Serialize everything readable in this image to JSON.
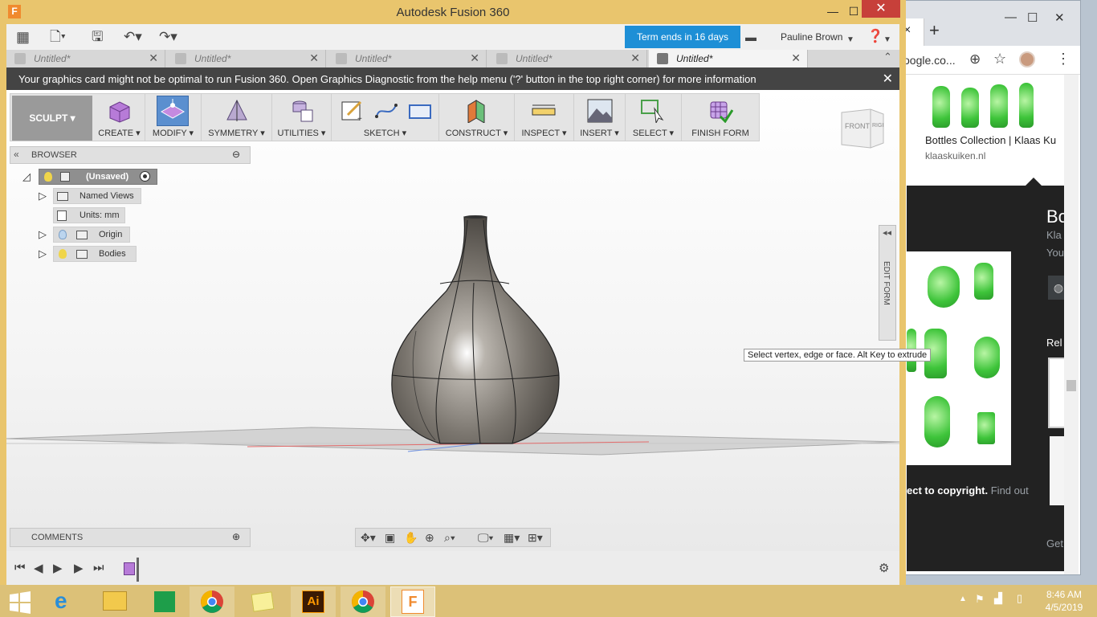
{
  "chrome": {
    "url_fragment": "oogle.co...",
    "result_title": "Bottles Collection | Klaas Ku",
    "result_site": "klaaskuiken.nl",
    "panel_title": "Bo",
    "panel_line1": "Kla",
    "panel_line2": "You",
    "related": "Rel",
    "copyright_bold": "ect to copyright.",
    "copyright_link": " Find out",
    "get": "Get"
  },
  "fusion": {
    "title": "Autodesk Fusion 360",
    "term": "Term ends in 16 days",
    "user": "Pauline Brown",
    "tabs": [
      {
        "label": "Untitled*"
      },
      {
        "label": "Untitled*"
      },
      {
        "label": "Untitled*"
      },
      {
        "label": "Untitled*"
      },
      {
        "label": "Untitled*"
      }
    ],
    "notice": "Your graphics card might not be optimal to run Fusion 360. Open Graphics Diagnostic from the help menu ('?' button in the top right corner) for more information",
    "workspace": "SCULPT",
    "toolbar": {
      "create": "CREATE",
      "modify": "MODIFY",
      "symmetry": "SYMMETRY",
      "utilities": "UTILITIES",
      "sketch": "SKETCH",
      "construct": "CONSTRUCT",
      "inspect": "INSPECT",
      "insert": "INSERT",
      "select": "SELECT",
      "finish": "FINISH FORM"
    },
    "viewcube": {
      "front": "FRONT",
      "right": "RIGHT"
    },
    "browser": {
      "title": "BROWSER",
      "root": "(Unsaved)",
      "named_views": "Named Views",
      "units": "Units: mm",
      "origin": "Origin",
      "bodies": "Bodies"
    },
    "edit_form": "EDIT FORM",
    "tooltip": "Select vertex, edge or face. Alt Key to extrude",
    "comments": "COMMENTS"
  },
  "taskbar": {
    "time": "8:46 AM",
    "date": "4/5/2019",
    "illustrator": "Ai"
  }
}
